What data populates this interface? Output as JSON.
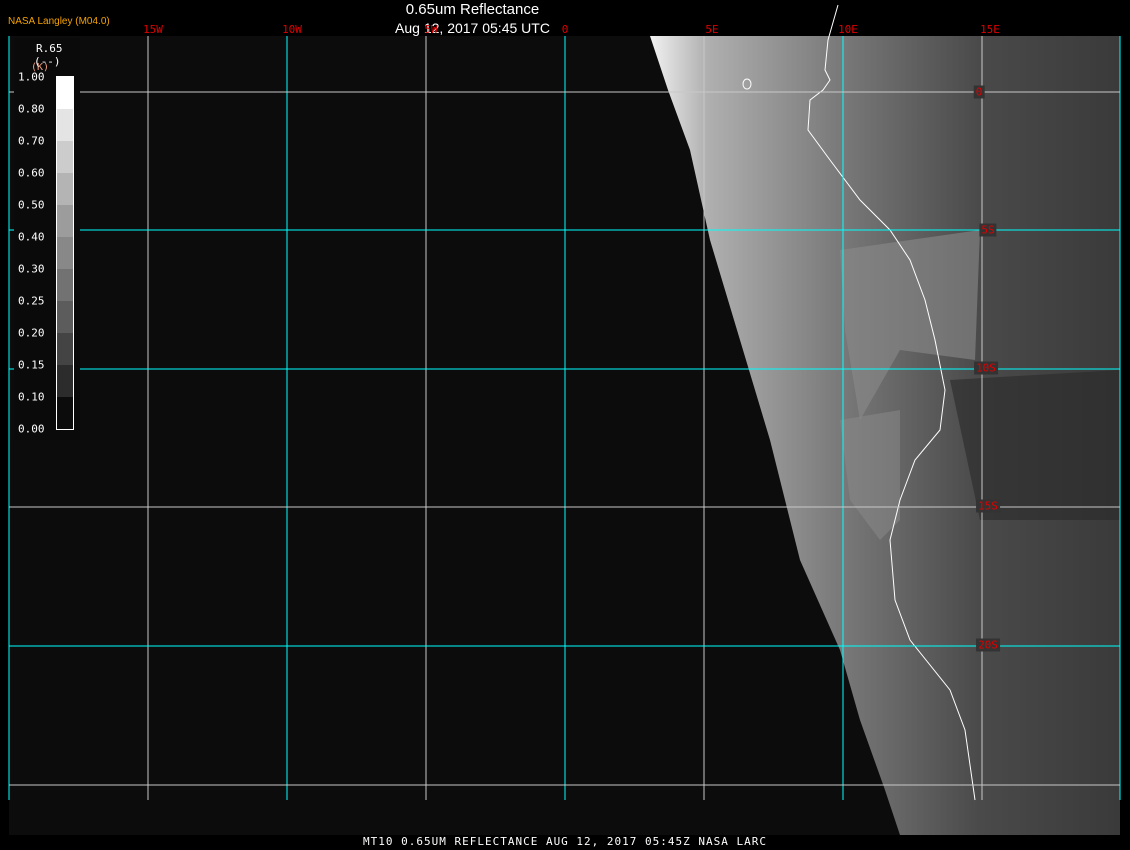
{
  "header": {
    "title": "0.65um Reflectance",
    "datetime": "Aug 12, 2017 05:45 UTC",
    "brand": "NASA Langley (M04.0)"
  },
  "longitude_labels": [
    "15W",
    "10W",
    "5W",
    "0",
    "5E",
    "10E",
    "15E"
  ],
  "latitude_labels": [
    "0",
    "5S",
    "10S",
    "15S",
    "20S"
  ],
  "legend": {
    "variable": "R.65",
    "units": "(--)",
    "units_overlay": "(K)",
    "ticks": [
      "1.00",
      "0.80",
      "0.70",
      "0.60",
      "0.50",
      "0.40",
      "0.30",
      "0.25",
      "0.20",
      "0.15",
      "0.10",
      "0.00"
    ],
    "colors": [
      "#ffffff",
      "#e4e4e4",
      "#cccccc",
      "#b4b4b4",
      "#9c9c9c",
      "#888888",
      "#727272",
      "#5c5c5c",
      "#444444",
      "#2c2c2c",
      "#0c0c0c"
    ]
  },
  "footer": {
    "text": "MT10  0.65UM REFLECTANCE   AUG 12, 2017 05:45Z   NASA LARC"
  },
  "colors": {
    "grid_cyan": "#00ffff",
    "grid_gray": "#c8c8c8",
    "label_red": "#e00000",
    "brand": "#f5a300"
  }
}
